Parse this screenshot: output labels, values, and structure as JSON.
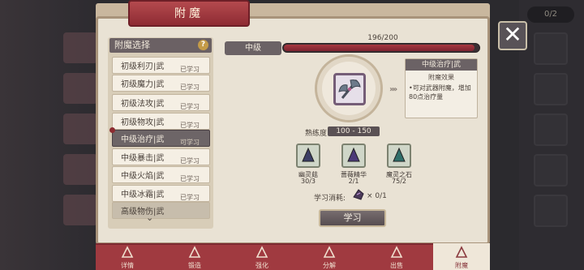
{
  "header": {
    "title": "附魔"
  },
  "list": {
    "header": "附魔选择",
    "help_glyph": "?",
    "items": [
      {
        "name": "初级利刃|武",
        "status": "已学习"
      },
      {
        "name": "初级魔力|武",
        "status": "已学习"
      },
      {
        "name": "初级法攻|武",
        "status": "已学习"
      },
      {
        "name": "初级物攻|武",
        "status": "已学习"
      },
      {
        "name": "中级治疗|武",
        "status": "可学习"
      },
      {
        "name": "中级暴击|武",
        "status": "已学习"
      },
      {
        "name": "中级火焰|武",
        "status": "已学习"
      },
      {
        "name": "中级冰霜|武",
        "status": "已学习"
      },
      {
        "name": "高级物伤|武",
        "status": ""
      }
    ],
    "selected_index": 4
  },
  "detail": {
    "tier": "中级",
    "progress_text": "196/200",
    "progress_value": 196,
    "progress_max": 200,
    "arrows": "»»",
    "skill_title": "中级治疗|武",
    "effect_label": "附魔效果",
    "effect_text": "•可对武器附魔，增加80点治疗量",
    "proficiency_label": "熟练度",
    "proficiency_value": "100 - 150",
    "materials": [
      {
        "name": "幽灵菇",
        "count": "30/3",
        "icon": "ghost-mushroom-icon",
        "color": "#3b3f66"
      },
      {
        "name": "蔷薇精华",
        "count": "2/1",
        "icon": "rose-essence-icon",
        "color": "#4b3a78"
      },
      {
        "name": "魔灵之石",
        "count": "75/2",
        "icon": "spirit-stone-icon",
        "color": "#2f6f6a"
      }
    ],
    "cost_label": "学习消耗:",
    "cost_count": "× 0/1",
    "learn_button": "学习"
  },
  "bottom_nav": [
    {
      "label": "详情",
      "icon": "details-icon"
    },
    {
      "label": "锻造",
      "icon": "forge-icon"
    },
    {
      "label": "强化",
      "icon": "enhance-icon"
    },
    {
      "label": "分解",
      "icon": "decompose-icon"
    },
    {
      "label": "出售",
      "icon": "sell-icon"
    },
    {
      "label": "附魔",
      "icon": "enchant-icon",
      "active": true
    }
  ],
  "top_badge": "0/2",
  "colors": {
    "accent": "#a03a40",
    "panel": "#e9e2d4",
    "dark_tag": "#6b6265"
  }
}
